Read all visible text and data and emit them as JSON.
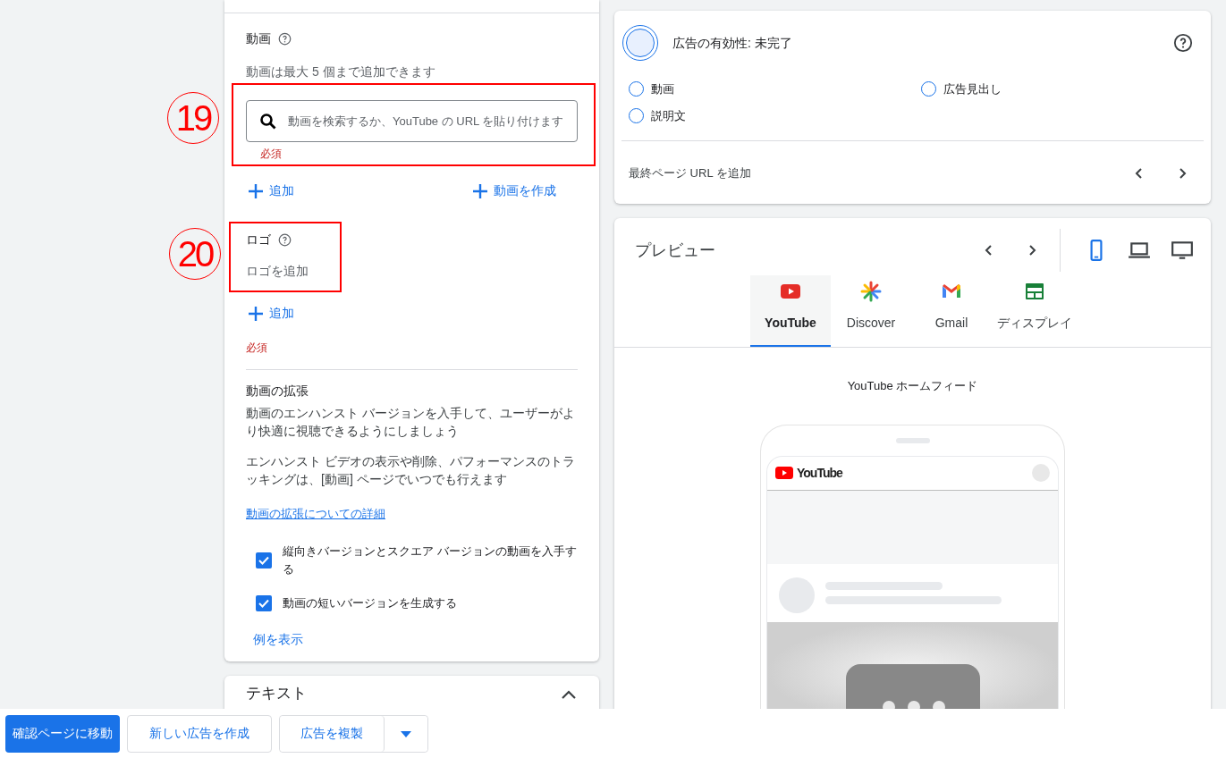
{
  "video_section": {
    "title": "動画",
    "hint": "動画は最大 5 個まで追加できます",
    "search": {
      "placeholder": "動画を検索するか、YouTube の URL を貼り付けます"
    },
    "error": "必須",
    "actions": [
      "追加",
      "動画を作成"
    ]
  },
  "logo_section": {
    "title": "ロゴ",
    "hint": "ロゴを追加",
    "action": "追加",
    "error": "必須"
  },
  "enhancement": {
    "title": "動画の拡張",
    "paragraphs": [
      "動画のエンハンスト バージョンを入手して、ユーザーがより快適に視聴できるようにしましょう",
      "エンハンスト ビデオの表示や削除、パフォーマンスのトラッキングは、[動画] ページでいつでも行えます"
    ],
    "link": "動画の拡張についての詳細",
    "options": [
      {
        "label": "縦向きバージョンとスクエア バージョンの動画を入手する",
        "checked": true
      },
      {
        "label": "動画の短いバージョンを生成する",
        "checked": true
      }
    ],
    "example_link": "例を表示"
  },
  "text_card": {
    "title": "テキスト",
    "expanded": true
  },
  "ad_strength": {
    "title": "広告の有効性: 未完了",
    "checklist": [
      {
        "label": "動画",
        "done": false
      },
      {
        "label": "広告見出し",
        "done": false
      },
      {
        "label": "説明文",
        "done": false
      }
    ],
    "url_hint": "最終ページ URL を追加"
  },
  "preview": {
    "title": "プレビュー",
    "devices": [
      {
        "kind": "mobile",
        "selected": true
      },
      {
        "kind": "laptop",
        "selected": false
      },
      {
        "kind": "desktop",
        "selected": false
      }
    ],
    "tabs": [
      {
        "label": "YouTube",
        "kind": "youtube",
        "selected": true
      },
      {
        "label": "Discover",
        "kind": "discover",
        "selected": false
      },
      {
        "label": "Gmail",
        "kind": "gmail",
        "selected": false
      },
      {
        "label": "ディスプレイ",
        "kind": "display",
        "selected": false
      }
    ],
    "placement": "YouTube ホームフィード",
    "phone_logo": "YouTube"
  },
  "annotations": [
    {
      "label": "19"
    },
    {
      "label": "20"
    }
  ],
  "footer": {
    "buttons": [
      {
        "label": "確認ページに移動",
        "kind": "primary"
      },
      {
        "label": "新しい広告を作成",
        "kind": "outline"
      },
      {
        "label": "広告を複製",
        "kind": "split"
      }
    ]
  }
}
